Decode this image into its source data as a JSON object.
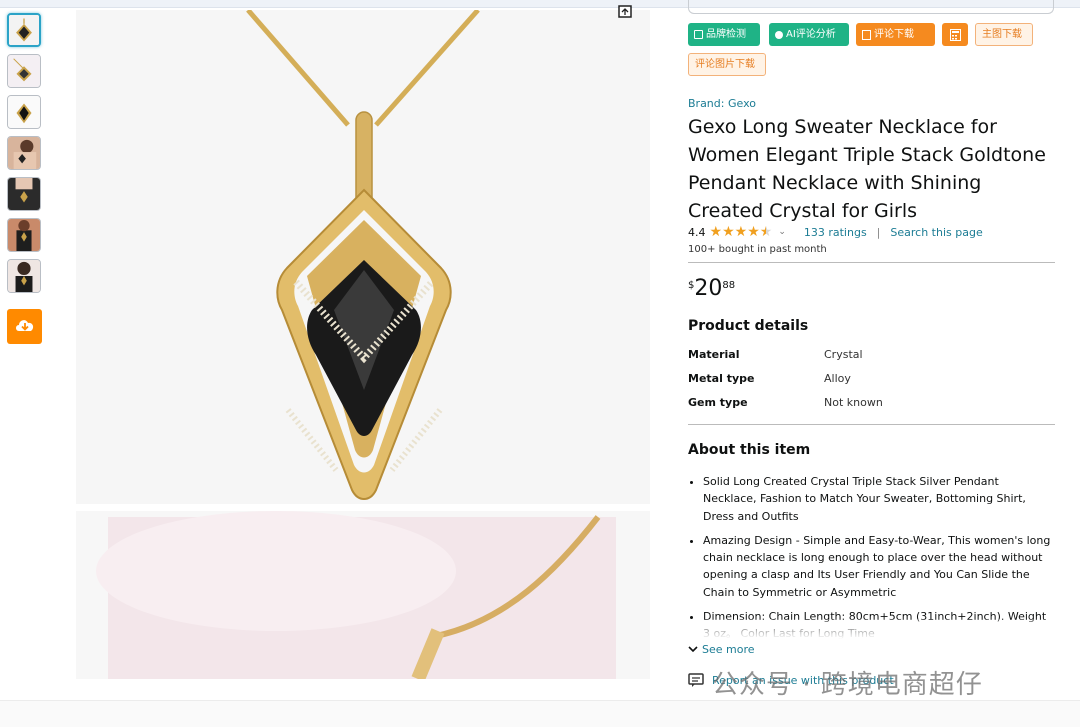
{
  "toolbar": {
    "btn1": "品牌检测",
    "btn2": "AI评论分析",
    "btn3": "评论下载",
    "btn5": "主图下载",
    "btn6": "评论图片下载"
  },
  "product": {
    "brand": "Brand: Gexo",
    "title": "Gexo Long Sweater Necklace for Women Elegant Triple Stack Goldtone Pendant Necklace with Shining Created Crystal for Girls",
    "rating": "4.4",
    "ratings_count": "133 ratings",
    "separator": "|",
    "search_page": "Search this page",
    "bought": "100+ bought in past month",
    "price_symbol": "$",
    "price_whole": "20",
    "price_fraction": "88"
  },
  "details": {
    "heading": "Product details",
    "rows": [
      {
        "label": "Material",
        "value": "Crystal"
      },
      {
        "label": "Metal type",
        "value": "Alloy"
      },
      {
        "label": "Gem type",
        "value": "Not known"
      }
    ]
  },
  "about": {
    "heading": "About this item",
    "items": [
      "Solid Long Created Crystal Triple Stack Silver Pendant Necklace, Fashion to Match Your Sweater, Bottoming Shirt, Dress and Outfits",
      "Amazing Design - Simple and Easy-to-Wear, This women's long chain necklace is long enough to place over the head without opening a clasp and Its User Friendly and You Can Slide the Chain to Symmetric or Asymmetric",
      "Dimension: Chain Length: 80cm+5cm (31inch+2inch). Weight 3 oz。 Color Last for Long Time"
    ],
    "see_more": "See more",
    "report": "Report an issue with this product"
  },
  "watermark": "公众号 · 跨境电商超仔",
  "colors": {
    "green": "#1fb386",
    "orange": "#f58a1f",
    "link": "#1c7c94",
    "star": "#f0a020"
  },
  "icons": [
    "expand-icon",
    "cloud-download-icon",
    "calculator-icon",
    "chevron-down-icon",
    "report-icon"
  ]
}
